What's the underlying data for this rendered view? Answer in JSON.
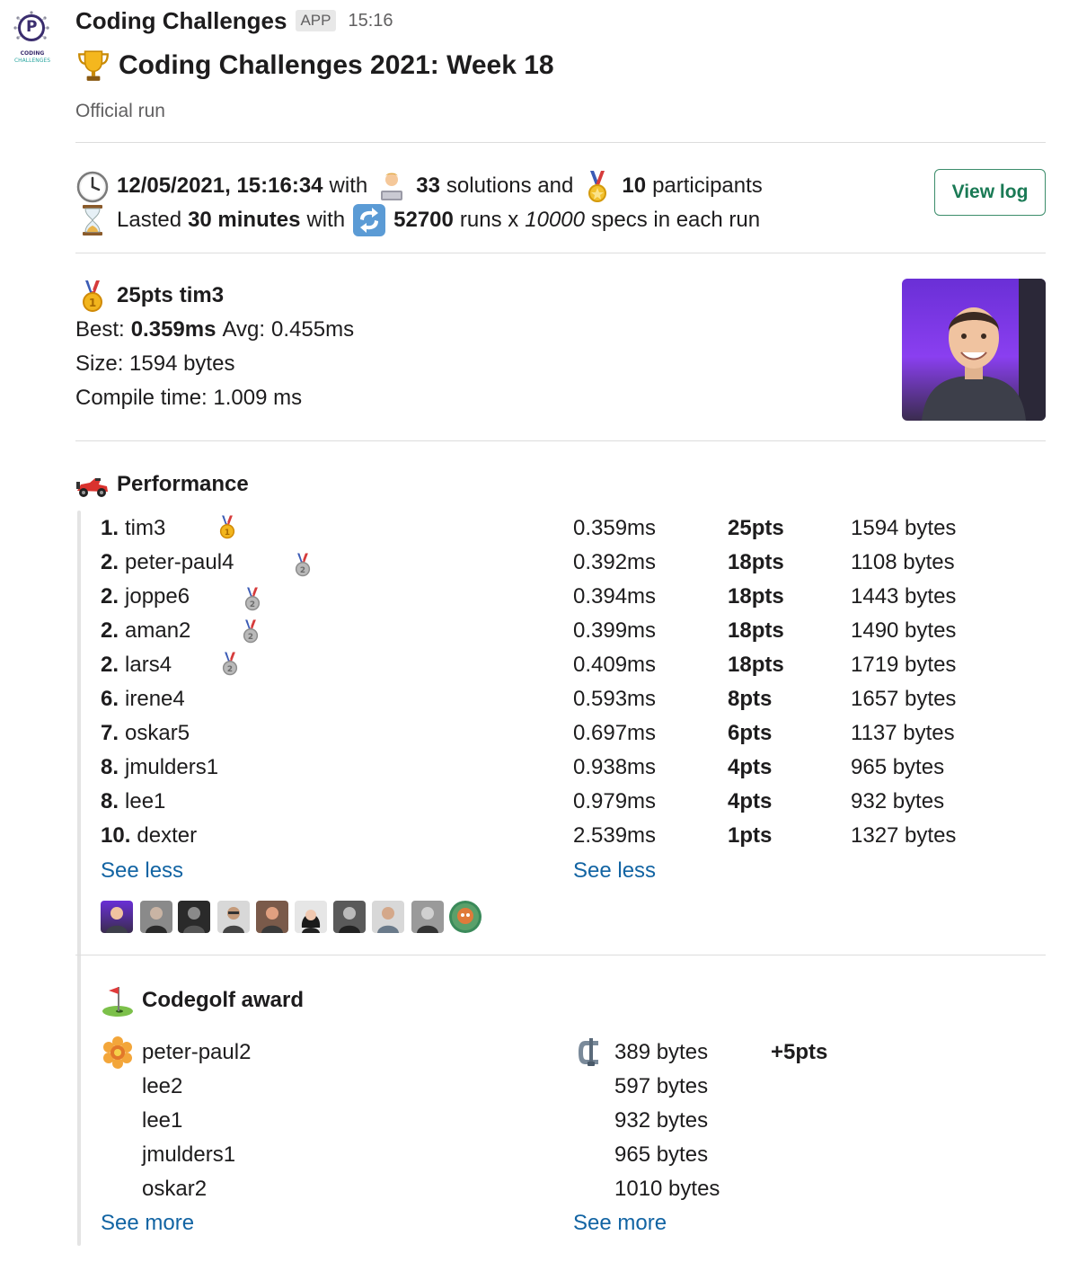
{
  "app": {
    "name": "Coding Challenges",
    "badge": "APP",
    "time": "15:16",
    "logo_text_1": "CODING",
    "logo_text_2": "CHALLENGES"
  },
  "message": {
    "title": "Coding Challenges 2021: Week 18",
    "subtitle": "Official run"
  },
  "run_info": {
    "datetime": "12/05/2021, 15:16:34",
    "with_1": "with",
    "solutions_count": "33",
    "solutions_text": "solutions and",
    "participants_count": "10",
    "participants_text": "participants",
    "lasted": "Lasted",
    "duration": "30 minutes",
    "with_2": "with",
    "runs_count": "52700",
    "runs_text": "runs x",
    "specs_count": "10000",
    "specs_text": "specs in each run",
    "view_log_label": "View log"
  },
  "winner": {
    "points": "25pts",
    "name": "tim3",
    "best_label": "Best:",
    "best_value": "0.359ms",
    "avg_label": "Avg:",
    "avg_value": "0.455ms",
    "size_text": "Size: 1594 bytes",
    "compile_text": "Compile time: 1.009 ms"
  },
  "performance": {
    "heading": "Performance",
    "rows": [
      {
        "rank": "1.",
        "name": "tim3",
        "medal": "gold",
        "time": "0.359ms",
        "points": "25pts",
        "size": "1594 bytes"
      },
      {
        "rank": "2.",
        "name": "peter-paul4",
        "medal": "silver",
        "time": "0.392ms",
        "points": "18pts",
        "size": "1108 bytes"
      },
      {
        "rank": "2.",
        "name": "joppe6",
        "medal": "silver",
        "time": "0.394ms",
        "points": "18pts",
        "size": "1443 bytes"
      },
      {
        "rank": "2.",
        "name": "aman2",
        "medal": "silver",
        "time": "0.399ms",
        "points": "18pts",
        "size": "1490 bytes"
      },
      {
        "rank": "2.",
        "name": "lars4",
        "medal": "silver",
        "time": "0.409ms",
        "points": "18pts",
        "size": "1719 bytes"
      },
      {
        "rank": "6.",
        "name": "irene4",
        "medal": "",
        "time": "0.593ms",
        "points": "8pts",
        "size": "1657 bytes"
      },
      {
        "rank": "7.",
        "name": "oskar5",
        "medal": "",
        "time": "0.697ms",
        "points": "6pts",
        "size": "1137 bytes"
      },
      {
        "rank": "8.",
        "name": "jmulders1",
        "medal": "",
        "time": "0.938ms",
        "points": "4pts",
        "size": "965 bytes"
      },
      {
        "rank": "8.",
        "name": "lee1",
        "medal": "",
        "time": "0.979ms",
        "points": "4pts",
        "size": "932 bytes"
      },
      {
        "rank": "10.",
        "name": "dexter",
        "medal": "",
        "time": "2.539ms",
        "points": "1pts",
        "size": "1327 bytes"
      }
    ],
    "see_less_left": "See less",
    "see_less_right": "See less"
  },
  "codegolf": {
    "heading": "Codegolf award",
    "rows": [
      {
        "name": "peter-paul2",
        "size": "389 bytes",
        "bonus": "+5pts"
      },
      {
        "name": "lee2",
        "size": "597 bytes",
        "bonus": ""
      },
      {
        "name": "lee1",
        "size": "932 bytes",
        "bonus": ""
      },
      {
        "name": "jmulders1",
        "size": "965 bytes",
        "bonus": ""
      },
      {
        "name": "oskar2",
        "size": "1010 bytes",
        "bonus": ""
      }
    ],
    "see_more_left": "See more",
    "see_more_right": "See more"
  },
  "icons": {
    "trophy": "trophy-icon",
    "clock": "clock-icon",
    "technologist": "technologist-icon",
    "medal": "sports-medal-icon",
    "hourglass": "hourglass-icon",
    "repeat": "repeat-arrows-icon",
    "gold_medal": "first-place-medal-icon",
    "silver_medal": "second-place-medal-icon",
    "race_car": "racing-car-icon",
    "golf": "golf-flag-icon",
    "rosette": "rosette-icon",
    "clamp": "clamp-icon"
  },
  "colors": {
    "link": "#1264a3",
    "view_log_border": "#3c8d6b",
    "view_log_text": "#1a7a55",
    "divider": "#dddddd",
    "muted": "#616061"
  }
}
